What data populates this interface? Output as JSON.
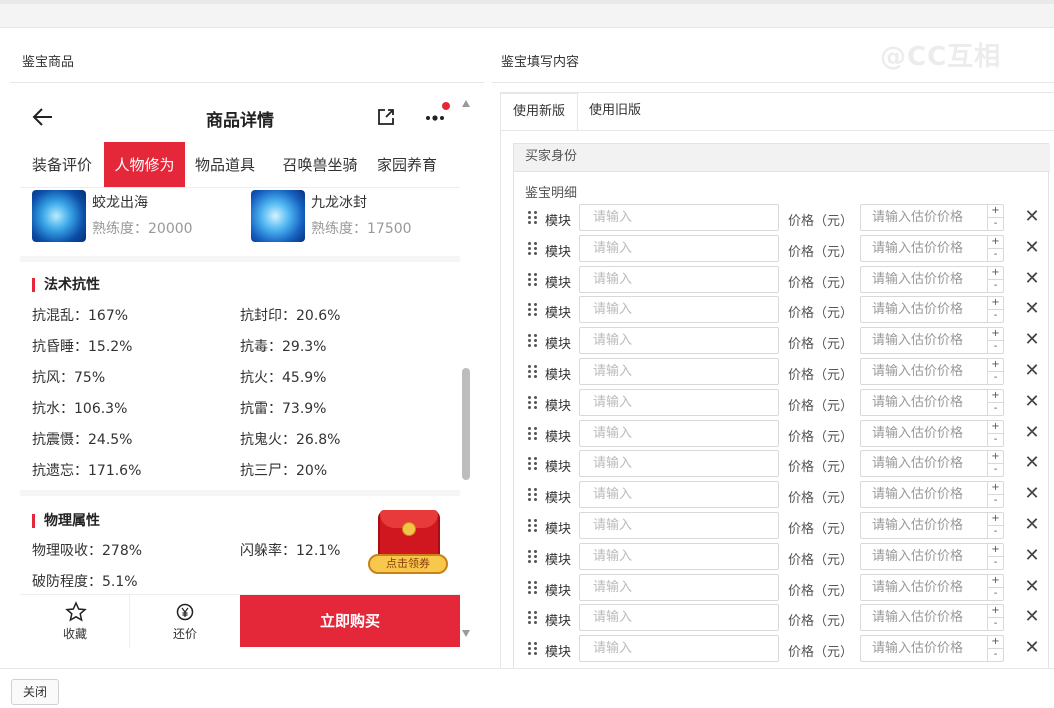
{
  "watermark": "@CC互相",
  "left_panel": {
    "title": "鉴宝商品"
  },
  "right_panel": {
    "title": "鉴宝填写内容"
  },
  "product": {
    "header_title": "商品详情",
    "tabs": [
      {
        "label": "装备评价",
        "active": false
      },
      {
        "label": "人物修为",
        "active": true
      },
      {
        "label": "物品道具",
        "active": false
      },
      {
        "label": "召唤兽坐骑",
        "active": false
      },
      {
        "label": "家园养育",
        "active": false
      }
    ],
    "pets": [
      {
        "name": "蛟龙出海",
        "exp": "熟练度：20000"
      },
      {
        "name": "九龙冰封",
        "exp": "熟练度：17500"
      }
    ],
    "magic_resist": {
      "title": "法术抗性",
      "items": [
        "抗混乱：167%",
        "抗封印：20.6%",
        "抗昏睡：15.2%",
        "抗毒：29.3%",
        "抗风：75%",
        "抗火：45.9%",
        "抗水：106.3%",
        "抗雷：73.9%",
        "抗震慑：24.5%",
        "抗鬼火：26.8%",
        "抗遗忘：171.6%",
        "抗三尸：20%"
      ]
    },
    "physical": {
      "title": "物理属性",
      "items": [
        "物理吸收：278%",
        "闪躲率：12.1%",
        "破防程度：5.1%"
      ]
    },
    "coupon_label": "点击领券",
    "bottom": {
      "fav": "收藏",
      "bargain": "还价",
      "buy": "立即购买"
    }
  },
  "form": {
    "tabs": [
      {
        "label": "使用新版",
        "active": true
      },
      {
        "label": "使用旧版",
        "active": false
      }
    ],
    "buyer_identity": "买家身份",
    "detail_label": "鉴宝明细",
    "row_label": "模块",
    "input_placeholder": "请输入",
    "price_label": "价格（元）",
    "price_placeholder": "请输入估价价格",
    "row_count": 15
  },
  "footer": {
    "close": "关闭"
  }
}
